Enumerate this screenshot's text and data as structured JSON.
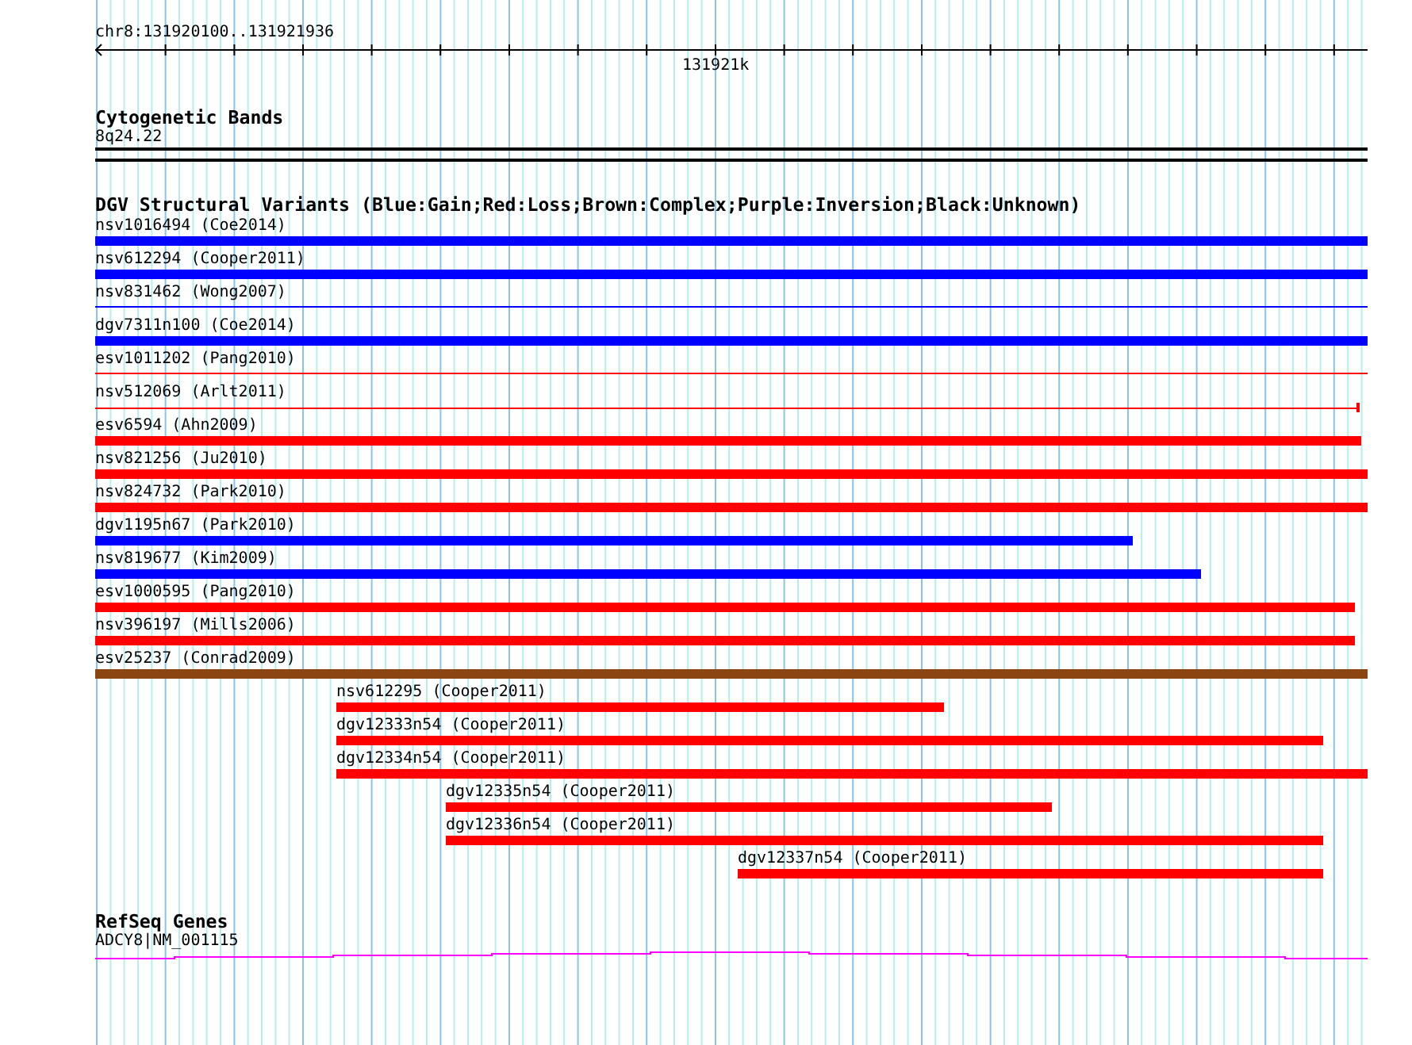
{
  "ruler": {
    "position": "chr8:131920100..131921936",
    "tick_label": "131921k"
  },
  "cytobands": {
    "title": "Cytogenetic Bands",
    "band": "8q24.22"
  },
  "variants": {
    "title": "DGV Structural Variants (Blue:Gain;Red:Loss;Brown:Complex;Purple:Inversion;Black:Unknown)",
    "features": [
      {
        "label": "nsv1016494 (Coe2014)",
        "color": "#0000ff",
        "kind": "thick"
      },
      {
        "label": "nsv612294 (Cooper2011)",
        "color": "#0000ff",
        "kind": "thick"
      },
      {
        "label": "nsv831462 (Wong2007)",
        "color": "#0000ff",
        "kind": "thin"
      },
      {
        "label": "dgv7311n100 (Coe2014)",
        "color": "#0000ff",
        "kind": "thick"
      },
      {
        "label": "esv1011202 (Pang2010)",
        "color": "#ff0000",
        "kind": "thin"
      },
      {
        "label": "nsv512069 (Arlt2011)",
        "color": "#ff0000",
        "kind": "thin"
      },
      {
        "label": "esv6594 (Ahn2009)",
        "color": "#ff0000",
        "kind": "thick"
      },
      {
        "label": "nsv821256 (Ju2010)",
        "color": "#ff0000",
        "kind": "thick"
      },
      {
        "label": "nsv824732 (Park2010)",
        "color": "#ff0000",
        "kind": "thick"
      },
      {
        "label": "dgv1195n67 (Park2010)",
        "color": "#0000ff",
        "kind": "thick"
      },
      {
        "label": "nsv819677 (Kim2009)",
        "color": "#0000ff",
        "kind": "thick"
      },
      {
        "label": "esv1000595 (Pang2010)",
        "color": "#ff0000",
        "kind": "thick"
      },
      {
        "label": "nsv396197 (Mills2006)",
        "color": "#ff0000",
        "kind": "thick"
      },
      {
        "label": "esv25237 (Conrad2009)",
        "color": "#8b4513",
        "kind": "thick"
      },
      {
        "label": "nsv612295 (Cooper2011)",
        "color": "#ff0000",
        "kind": "thick"
      },
      {
        "label": "dgv12333n54 (Cooper2011)",
        "color": "#ff0000",
        "kind": "thick"
      },
      {
        "label": "dgv12334n54 (Cooper2011)",
        "color": "#ff0000",
        "kind": "thick"
      },
      {
        "label": "dgv12335n54 (Cooper2011)",
        "color": "#ff0000",
        "kind": "thick"
      },
      {
        "label": "dgv12336n54 (Cooper2011)",
        "color": "#ff0000",
        "kind": "thick"
      },
      {
        "label": "dgv12337n54 (Cooper2011)",
        "color": "#ff0000",
        "kind": "thick"
      }
    ]
  },
  "genes": {
    "title": "RefSeq Genes",
    "features": [
      {
        "label": "ADCY8|NM_001115"
      }
    ]
  }
}
